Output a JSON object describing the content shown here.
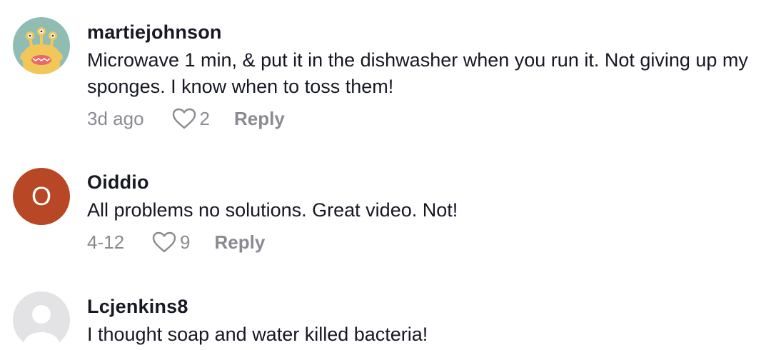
{
  "comments": [
    {
      "username": "martiejohnson",
      "text": "Microwave 1 min, & put it in the dishwasher when you run it. Not giving up my sponges. I know when to toss them!",
      "time": "3d ago",
      "likes": "2",
      "reply_label": "Reply",
      "avatar": {
        "type": "illustration",
        "icon": "alien-monster-avatar",
        "bg_color": "#8fbdb3"
      }
    },
    {
      "username": "Oiddio",
      "text": "All problems no solutions. Great video. Not!",
      "time": "4-12",
      "likes": "9",
      "reply_label": "Reply",
      "avatar": {
        "type": "letter",
        "letter": "O",
        "bg_color": "#b84726"
      }
    },
    {
      "username": "Lcjenkins8",
      "text": "I thought soap and water killed bacteria!",
      "avatar": {
        "type": "default",
        "icon": "default-user-avatar",
        "bg_color": "#e3e3e5"
      }
    }
  ],
  "colors": {
    "text_primary": "#161823",
    "text_secondary": "#8a8b91"
  }
}
